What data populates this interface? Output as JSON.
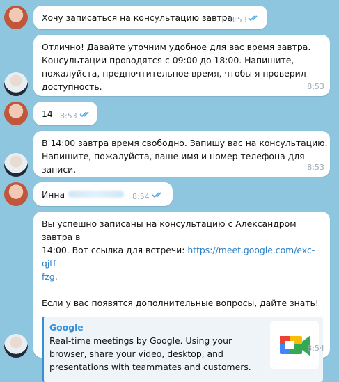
{
  "messages": [
    {
      "from": "user",
      "text": "Хочу записаться на консультацию завтра",
      "time": "8:53"
    },
    {
      "from": "bot",
      "text": "Отлично! Давайте уточним удобное для вас время завтра.\nКонсультации проводятся с 09:00 до 18:00. Напишите,\nпожалуйста, предпочтительное время, чтобы я проверил\nдоступность.",
      "time": "8:53"
    },
    {
      "from": "user",
      "text": "14",
      "time": "8:53"
    },
    {
      "from": "bot",
      "text": "В 14:00 завтра время свободно. Запишу вас на консультацию.\nНапишите, пожалуйста, ваше имя и номер телефона для записи.",
      "time": "8:53"
    },
    {
      "from": "user",
      "text": "Инна",
      "time": "8:54"
    },
    {
      "from": "bot",
      "text_part1": "Вы успешно записаны на консультацию с Александром завтра в\n14:00. Вот ссылка для встречи: ",
      "link": "https://meet.google.com/exc-qjtf-\nfzg",
      "text_part2": ".\n\nЕсли у вас появятся дополнительные вопросы, дайте знать!",
      "time": "8:54",
      "preview": {
        "site": "Google",
        "description": "Real-time meetings by Google. Using your browser, share your video, desktop, and presentations with teammates and customers."
      }
    }
  ],
  "colors": {
    "background": "#8ec6e0",
    "bubble": "#ffffff",
    "link": "#2b7fc6",
    "time": "#a0acb6",
    "read_ticks": "#4fa3e0"
  }
}
